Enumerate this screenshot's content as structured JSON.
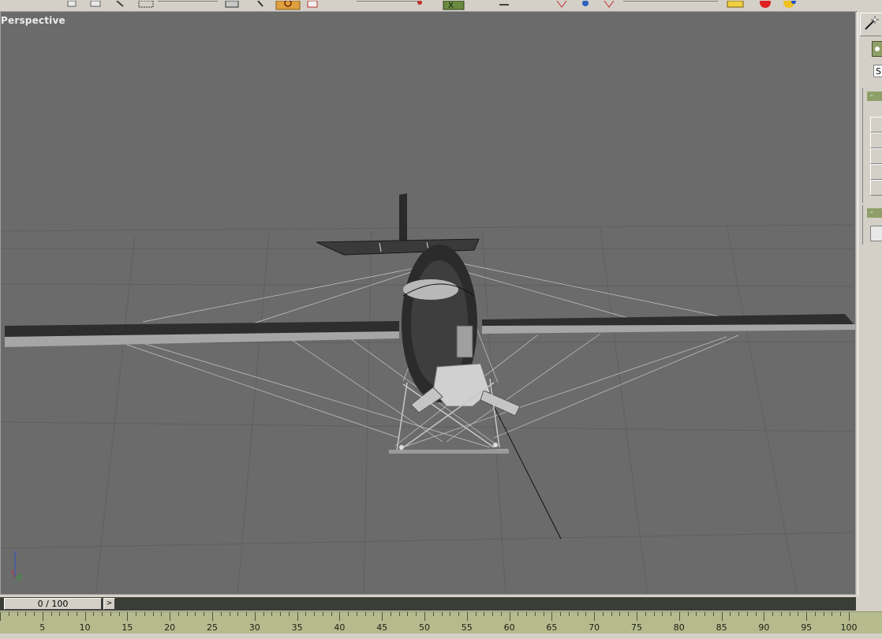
{
  "viewport": {
    "label": "Perspective",
    "background": "#6b6b6b",
    "axis_labels": {
      "z": "z",
      "x": "x",
      "y": "y"
    }
  },
  "toolbar": {
    "icons": [
      "select-icon",
      "move-icon",
      "rotate-icon",
      "region-select-icon",
      "named-selection-icon",
      "snap-icon",
      "angle-snap-icon",
      "mirror-icon",
      "align-icon",
      "curve-editor-icon",
      "render-icon",
      "teapot-icon"
    ]
  },
  "command_panel": {
    "field_text": "S",
    "rollout_1_sign": "-",
    "rollout_2_sign": "-"
  },
  "time_slider": {
    "position": "0 / 100",
    "next_label": ">",
    "current_frame": 0,
    "total_frames": 100
  },
  "track_bar": {
    "labels": [
      "5",
      "10",
      "15",
      "20",
      "25",
      "30",
      "35",
      "40",
      "45",
      "50",
      "55",
      "60",
      "65",
      "70",
      "75",
      "80",
      "85",
      "90",
      "95",
      "100"
    ]
  },
  "colors": {
    "ui_gray": "#d4d0c8",
    "trackbar": "#b5bb8d",
    "rollout_header": "#8f9f6a"
  }
}
